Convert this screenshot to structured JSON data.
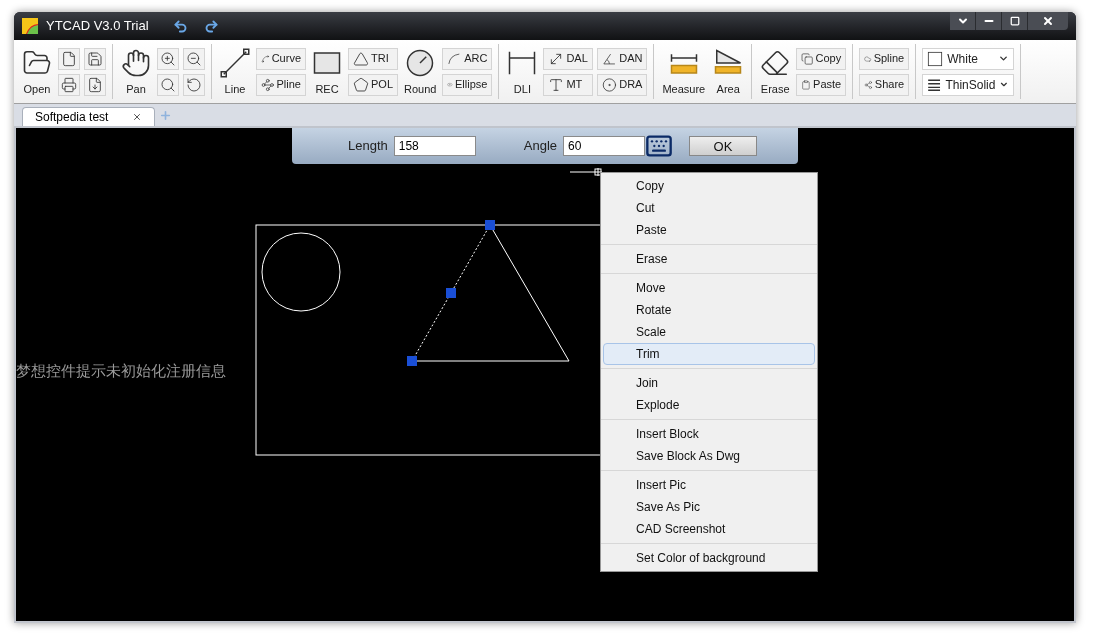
{
  "window": {
    "title": "YTCAD V3.0 Trial"
  },
  "toolbar": {
    "groups": [
      {
        "columns": [
          [
            {
              "kind": "large",
              "label": "Open"
            }
          ],
          [
            {
              "kind": "icon"
            },
            {
              "kind": "icon"
            }
          ],
          [
            {
              "kind": "icon"
            },
            {
              "kind": "icon"
            }
          ]
        ]
      },
      {
        "columns": [
          [
            {
              "kind": "large",
              "label": "Pan"
            }
          ],
          [
            {
              "kind": "icon"
            },
            {
              "kind": "icon"
            }
          ],
          [
            {
              "kind": "icon"
            },
            {
              "kind": "icon"
            }
          ]
        ]
      },
      {
        "columns": [
          [
            {
              "kind": "large",
              "label": "Line"
            }
          ],
          [
            {
              "kind": "small",
              "label": "Curve"
            },
            {
              "kind": "small",
              "label": "Pline"
            }
          ],
          [
            {
              "kind": "large",
              "label": "REC"
            }
          ],
          [
            {
              "kind": "small",
              "label": "TRI"
            },
            {
              "kind": "small",
              "label": "POL"
            }
          ],
          [
            {
              "kind": "large",
              "label": "Round"
            }
          ],
          [
            {
              "kind": "small",
              "label": "ARC"
            },
            {
              "kind": "small",
              "label": "Ellipse"
            }
          ]
        ]
      },
      {
        "columns": [
          [
            {
              "kind": "large",
              "label": "DLI"
            }
          ],
          [
            {
              "kind": "small",
              "label": "DAL"
            },
            {
              "kind": "small",
              "label": "MT"
            }
          ],
          [
            {
              "kind": "small",
              "label": "DAN"
            },
            {
              "kind": "small",
              "label": "DRA"
            }
          ]
        ]
      },
      {
        "columns": [
          [
            {
              "kind": "large",
              "label": "Measure"
            }
          ],
          [
            {
              "kind": "large",
              "label": "Area"
            }
          ]
        ]
      },
      {
        "columns": [
          [
            {
              "kind": "large",
              "label": "Erase"
            }
          ],
          [
            {
              "kind": "small",
              "label": "Copy"
            },
            {
              "kind": "small",
              "label": "Paste"
            }
          ]
        ]
      },
      {
        "columns": [
          [
            {
              "kind": "small",
              "label": "Spline"
            },
            {
              "kind": "small",
              "label": "Share"
            }
          ]
        ]
      },
      {
        "columns": [
          [
            {
              "kind": "dropdown",
              "label": "White"
            },
            {
              "kind": "dropdown",
              "label": "ThinSolid"
            }
          ]
        ]
      }
    ]
  },
  "tabs": [
    {
      "label": "Softpedia test",
      "selected": true
    }
  ],
  "input_bar": {
    "fields": [
      {
        "label": "Length",
        "value": "158"
      },
      {
        "label": "Angle",
        "value": "60"
      }
    ],
    "ok": "OK"
  },
  "canvas": {
    "notice": "梦想控件提示未初始化注册信息"
  },
  "context_menu": {
    "sections": [
      [
        {
          "label": "Copy",
          "selected": false
        },
        {
          "label": "Cut",
          "selected": false
        },
        {
          "label": "Paste",
          "selected": false
        }
      ],
      [
        {
          "label": "Erase",
          "selected": false
        }
      ],
      [
        {
          "label": "Move",
          "selected": false
        },
        {
          "label": "Rotate",
          "selected": false
        },
        {
          "label": "Scale",
          "selected": false
        },
        {
          "label": "Trim",
          "selected": true
        }
      ],
      [
        {
          "label": "Join",
          "selected": false
        },
        {
          "label": "Explode",
          "selected": false
        }
      ],
      [
        {
          "label": "Insert Block",
          "selected": false
        },
        {
          "label": "Save Block As Dwg",
          "selected": false
        }
      ],
      [
        {
          "label": "Insert Pic",
          "selected": false
        },
        {
          "label": "Save As Pic",
          "selected": false
        },
        {
          "label": "CAD Screenshot",
          "selected": false
        }
      ],
      [
        {
          "label": "Set Color of background",
          "selected": false
        }
      ]
    ]
  }
}
